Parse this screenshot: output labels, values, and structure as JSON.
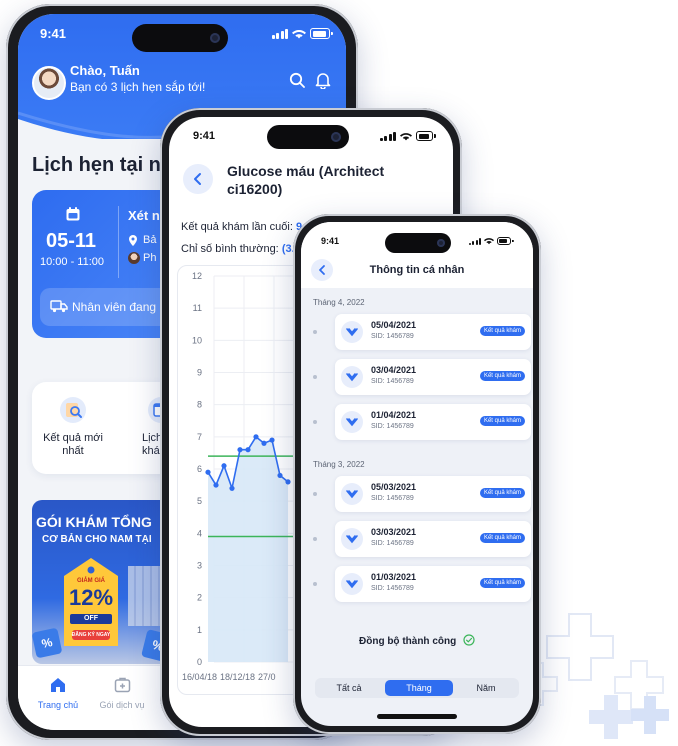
{
  "colors": {
    "primary": "#2f6df0",
    "accent_green": "#3cb55a",
    "chart_fill": "#d7e8f7",
    "chart_line": "#2f6df0"
  },
  "phone1": {
    "time": "9:41",
    "greeting": "Chào, Tuấn",
    "subtitle": "Bạn có 3 lịch hẹn sắp tới!",
    "section_title": "Lịch hẹn tại n",
    "appointment": {
      "date": "05-11",
      "time_range": "10:00 - 11:00",
      "title": "Xét n",
      "location": "Bả",
      "doctor": "Ph"
    },
    "staff_status": "Nhân viên đang",
    "services": [
      {
        "label": "Kết quả mới nhất",
        "icon": "result-search-icon"
      },
      {
        "label": "Lịch s khám",
        "icon": "history-icon"
      }
    ],
    "promo": {
      "title": "GÓI KHÁM TỔNG",
      "subtitle": "CƠ BẢN CHO NAM TẠI",
      "tag_top": "GIẢM GIÁ",
      "discount": "12%",
      "off": "OFF",
      "cta": "ĐĂNG KÝ NGAY"
    },
    "tabs": [
      {
        "label": "Trang chủ",
        "icon": "home-icon"
      },
      {
        "label": "Gói dịch vụ",
        "icon": "package-icon"
      }
    ]
  },
  "phone2": {
    "time": "9:41",
    "title": "Glucose máu (Architect ci16200)",
    "last_result_label": "Kết quả khám lần cuối:",
    "last_result_value": "9.",
    "normal_label": "Chỉ số bình thường:",
    "normal_value": "(3."
  },
  "chart_data": {
    "type": "line",
    "ylim": [
      0,
      12
    ],
    "yticks": [
      0,
      1,
      2,
      3,
      4,
      5,
      6,
      7,
      8,
      9,
      10,
      11,
      12
    ],
    "xtick_labels": [
      "16/04/18",
      "18/12/18",
      "27/0"
    ],
    "reference_lines": [
      3.9,
      6.4
    ],
    "series": [
      {
        "values": [
          5.9,
          5.5,
          6.1,
          5.4,
          6.6,
          6.6,
          7.0,
          6.8,
          6.9,
          5.8,
          5.6
        ]
      }
    ],
    "grid": true
  },
  "phone3": {
    "time": "9:41",
    "title": "Thông tin cá nhân",
    "groups": [
      {
        "month": "Tháng 4, 2022",
        "items": [
          {
            "date": "05/04/2021",
            "sid": "SID: 1456789",
            "badge": "Kết quả khám"
          },
          {
            "date": "03/04/2021",
            "sid": "SID: 1456789",
            "badge": "Kết quả khám"
          },
          {
            "date": "01/04/2021",
            "sid": "SID: 1456789",
            "badge": "Kết quả khám"
          }
        ]
      },
      {
        "month": "Tháng 3, 2022",
        "items": [
          {
            "date": "05/03/2021",
            "sid": "SID: 1456789",
            "badge": "Kết quả khám"
          },
          {
            "date": "03/03/2021",
            "sid": "SID: 1456789",
            "badge": "Kết quả khám"
          },
          {
            "date": "01/03/2021",
            "sid": "SID: 1456789",
            "badge": "Kết quả khám"
          }
        ]
      }
    ],
    "sync": "Đồng bộ thành công",
    "segments": [
      "Tất cả",
      "Tháng",
      "Năm"
    ],
    "selected_segment": "Tháng"
  }
}
